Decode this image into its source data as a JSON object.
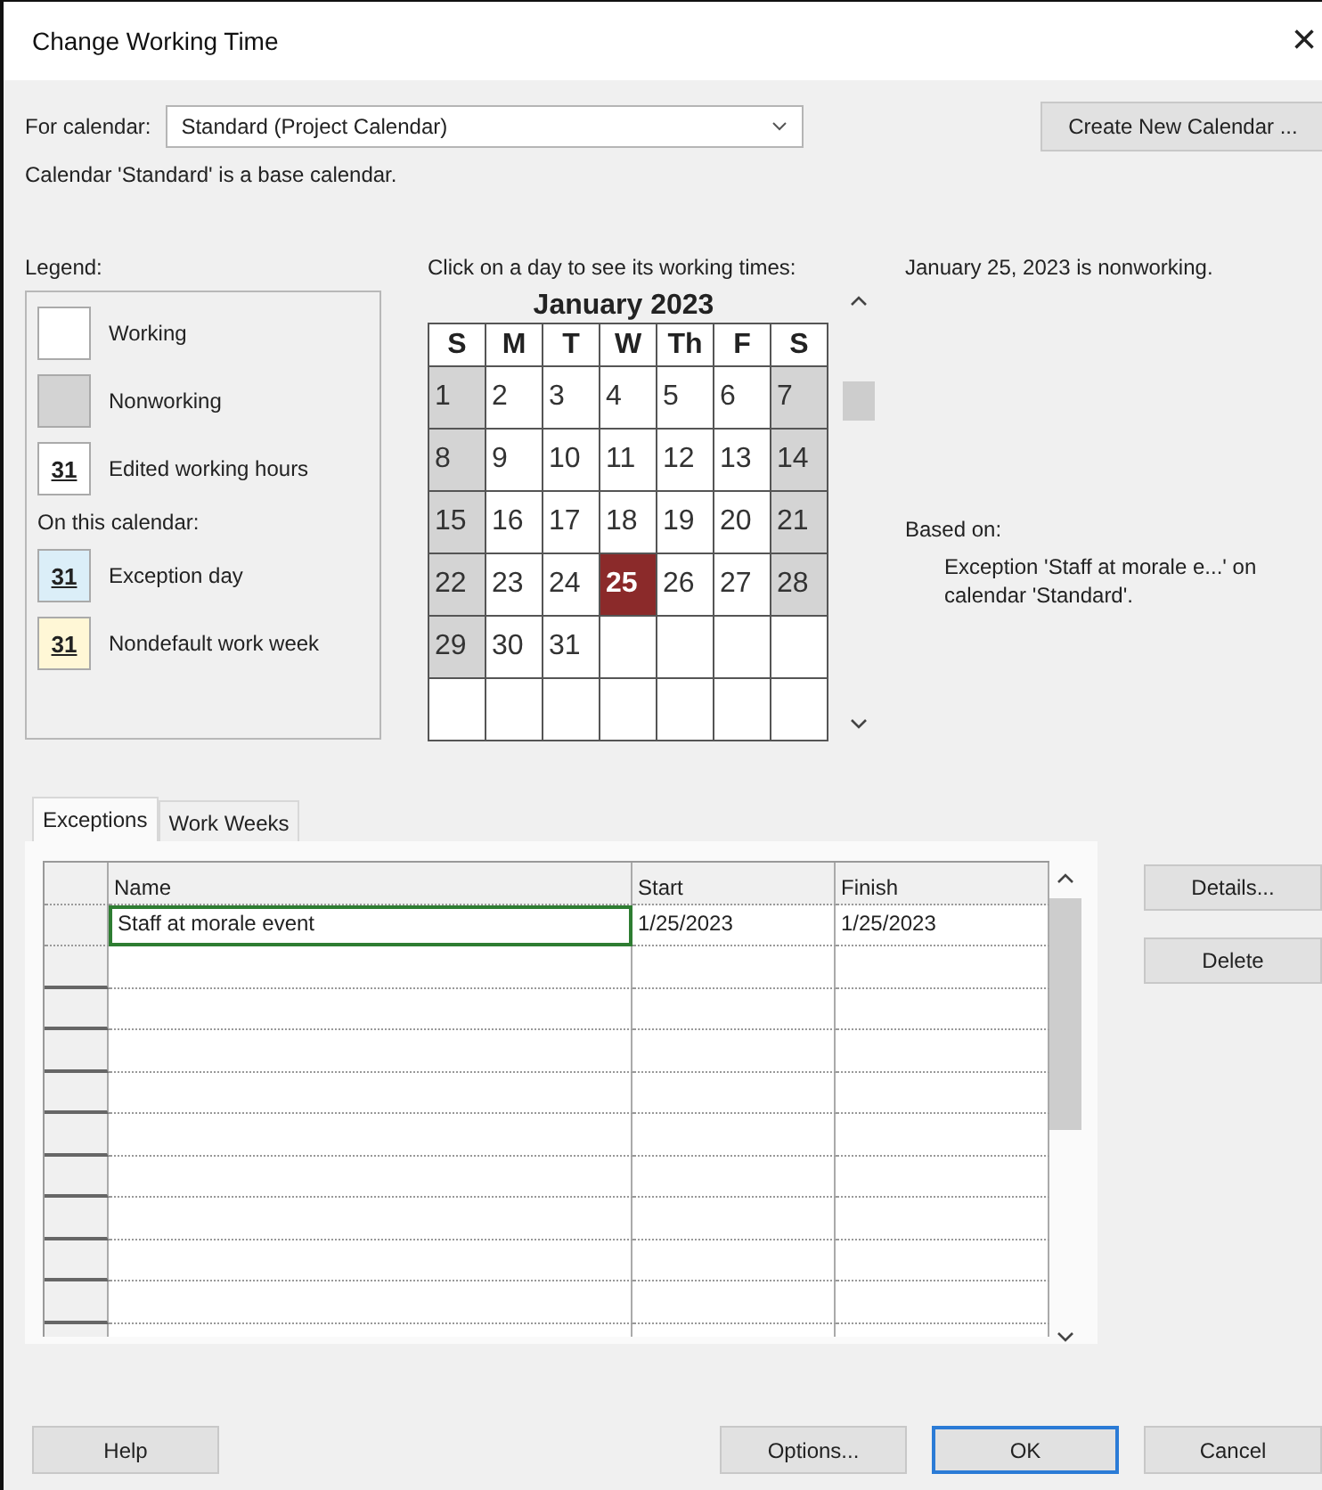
{
  "window": {
    "title": "Change Working Time",
    "close": "×"
  },
  "for_calendar": {
    "label": "For calendar:",
    "value": "Standard (Project Calendar)"
  },
  "create_button": "Create New Calendar ...",
  "base_note": "Calendar 'Standard' is a base calendar.",
  "legend": {
    "title": "Legend:",
    "items": [
      {
        "kind": "working",
        "label": "Working"
      },
      {
        "kind": "nonworking",
        "label": "Nonworking"
      },
      {
        "kind": "edited",
        "swatch": "31",
        "label": "Edited working hours"
      }
    ],
    "subheading": "On this calendar:",
    "calendar_items": [
      {
        "kind": "exception",
        "swatch": "31",
        "label": "Exception day"
      },
      {
        "kind": "nondefault",
        "swatch": "31",
        "label": "Nondefault work week"
      }
    ]
  },
  "calendar": {
    "instruction": "Click on a day to see its working times:",
    "month": "January 2023",
    "weekdays": [
      "S",
      "M",
      "T",
      "W",
      "Th",
      "F",
      "S"
    ],
    "weeks": [
      [
        {
          "day": "1",
          "nonworking": true,
          "selected": false
        },
        {
          "day": "2",
          "nonworking": false,
          "selected": false
        },
        {
          "day": "3",
          "nonworking": false,
          "selected": false
        },
        {
          "day": "4",
          "nonworking": false,
          "selected": false
        },
        {
          "day": "5",
          "nonworking": false,
          "selected": false
        },
        {
          "day": "6",
          "nonworking": false,
          "selected": false
        },
        {
          "day": "7",
          "nonworking": true,
          "selected": false
        }
      ],
      [
        {
          "day": "8",
          "nonworking": true,
          "selected": false
        },
        {
          "day": "9",
          "nonworking": false,
          "selected": false
        },
        {
          "day": "10",
          "nonworking": false,
          "selected": false
        },
        {
          "day": "11",
          "nonworking": false,
          "selected": false
        },
        {
          "day": "12",
          "nonworking": false,
          "selected": false
        },
        {
          "day": "13",
          "nonworking": false,
          "selected": false
        },
        {
          "day": "14",
          "nonworking": true,
          "selected": false
        }
      ],
      [
        {
          "day": "15",
          "nonworking": true,
          "selected": false
        },
        {
          "day": "16",
          "nonworking": false,
          "selected": false
        },
        {
          "day": "17",
          "nonworking": false,
          "selected": false
        },
        {
          "day": "18",
          "nonworking": false,
          "selected": false
        },
        {
          "day": "19",
          "nonworking": false,
          "selected": false
        },
        {
          "day": "20",
          "nonworking": false,
          "selected": false
        },
        {
          "day": "21",
          "nonworking": true,
          "selected": false
        }
      ],
      [
        {
          "day": "22",
          "nonworking": true,
          "selected": false
        },
        {
          "day": "23",
          "nonworking": false,
          "selected": false
        },
        {
          "day": "24",
          "nonworking": false,
          "selected": false
        },
        {
          "day": "25",
          "nonworking": true,
          "selected": true
        },
        {
          "day": "26",
          "nonworking": false,
          "selected": false
        },
        {
          "day": "27",
          "nonworking": false,
          "selected": false
        },
        {
          "day": "28",
          "nonworking": true,
          "selected": false
        }
      ],
      [
        {
          "day": "29",
          "nonworking": true,
          "selected": false
        },
        {
          "day": "30",
          "nonworking": false,
          "selected": false
        },
        {
          "day": "31",
          "nonworking": false,
          "selected": false
        }
      ]
    ]
  },
  "status": "January 25, 2023 is nonworking.",
  "based_on": {
    "label": "Based on:",
    "text": "Exception 'Staff at morale e...' on calendar 'Standard'."
  },
  "tabs": [
    {
      "label": "Exceptions",
      "selected": true
    },
    {
      "label": "Work Weeks",
      "selected": false
    }
  ],
  "table": {
    "columns": [
      "Name",
      "Start",
      "Finish"
    ],
    "rows": [
      {
        "name": "Staff at morale event",
        "start": "1/25/2023",
        "finish": "1/25/2023",
        "editing": true
      }
    ]
  },
  "side_buttons": [
    "Details...",
    "Delete"
  ],
  "footer": {
    "help": "Help",
    "buttons": [
      {
        "label": "Options...",
        "default": false
      },
      {
        "label": "OK",
        "default": true
      },
      {
        "label": "Cancel",
        "default": false
      }
    ]
  }
}
